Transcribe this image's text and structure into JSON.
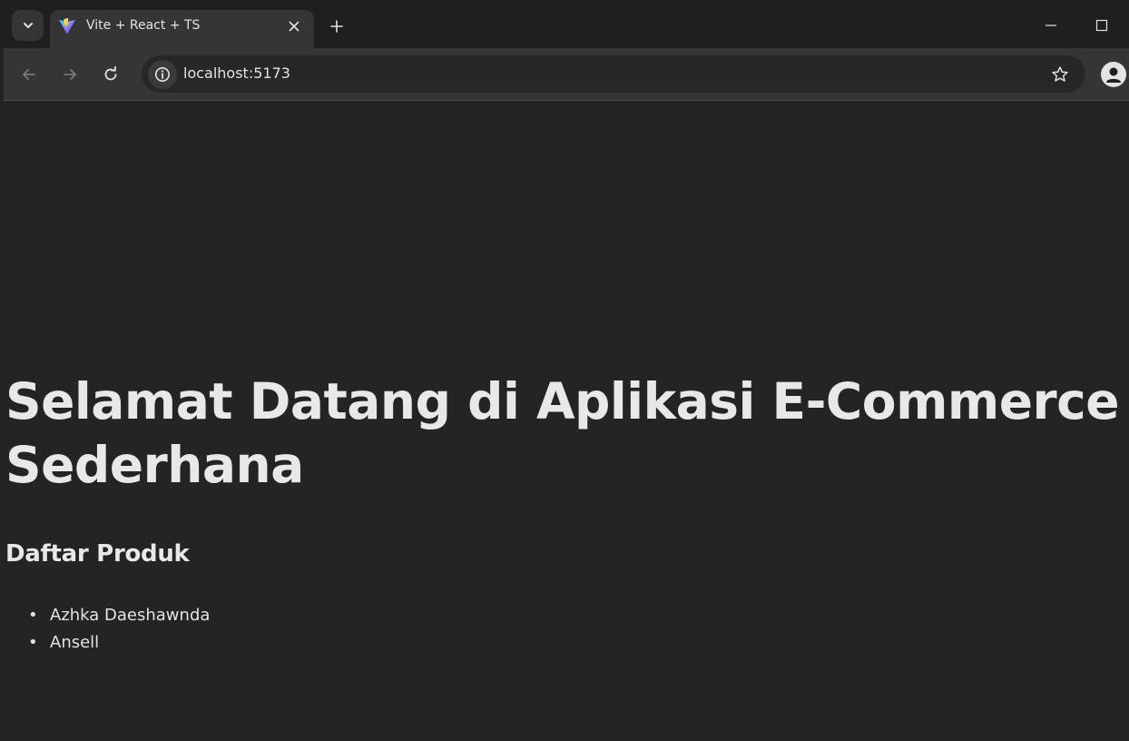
{
  "browser": {
    "tab": {
      "title": "Vite + React + TS"
    },
    "address_bar": {
      "url": "localhost:5173"
    },
    "theme": {
      "frame": "#1f1f1f",
      "toolbar": "#353535",
      "omnibox": "#272727",
      "page": "#242424"
    }
  },
  "page": {
    "heading": "Selamat Datang di Aplikasi E-Commerce Sederhana",
    "products_heading": "Daftar Produk",
    "products": [
      {
        "name": "Azhka Daeshawnda"
      },
      {
        "name": "Ansell"
      }
    ]
  },
  "icons": {
    "tab_search": "chevron-down-icon",
    "favicon": "vite-logo-icon",
    "tab_close": "close-icon",
    "new_tab": "plus-icon",
    "minimize": "minimize-icon",
    "maximize": "maximize-icon",
    "back": "arrow-left-icon",
    "forward": "arrow-right-icon",
    "reload": "reload-icon",
    "site_info": "info-icon",
    "bookmark": "star-icon",
    "profile": "person-icon"
  }
}
